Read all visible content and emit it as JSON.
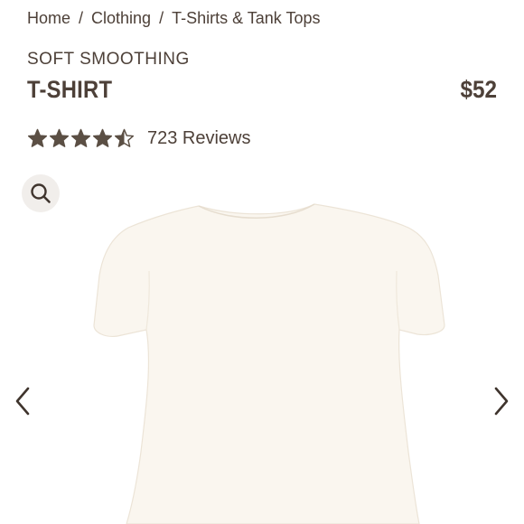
{
  "breadcrumb": {
    "items": [
      "Home",
      "Clothing",
      "T-Shirts & Tank Tops"
    ],
    "separator": "/"
  },
  "product": {
    "collection": "SOFT SMOOTHING",
    "name": "T-SHIRT",
    "price": "$52",
    "rating_value": 4.5,
    "reviews_label": "723 Reviews",
    "image_alt": "T-SHIRT",
    "image_color": "#faf6ef"
  },
  "icons": {
    "zoom": "search-icon",
    "prev": "chevron-left-icon",
    "next": "chevron-right-icon",
    "star": "star-icon"
  },
  "colors": {
    "text": "#4d4038",
    "star": "#5b4f44",
    "zoom_bg": "#f1eeeb"
  }
}
